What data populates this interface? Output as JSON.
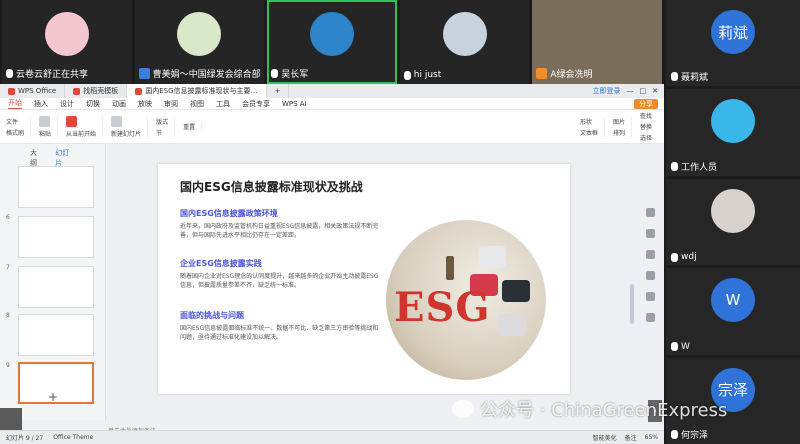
{
  "meeting": {
    "top_tiles": [
      {
        "label": "云卷云舒正在共享",
        "color": "#f3c6d0"
      },
      {
        "label": "曹美娟～中国绿发会综合部",
        "color": "#d9e8c8"
      },
      {
        "label": "吴长军",
        "color": "#2d84c8"
      },
      {
        "label": "hi just",
        "color": "#c8d2dc"
      },
      {
        "label": "A绿会冼明",
        "color": "#7a6d5b"
      }
    ],
    "right_tiles": [
      {
        "label": "聂莉斌",
        "avatar_text": "莉斌",
        "color": "#2f73d9"
      },
      {
        "label": "工作人员",
        "avatar_text": "",
        "color": "#39b7e8"
      },
      {
        "label": "wdj",
        "avatar_text": "",
        "color": "#d8d2cc"
      },
      {
        "label": "W",
        "avatar_text": "W",
        "color": "#2f73d9"
      },
      {
        "label": "何宗泽",
        "avatar_text": "宗泽",
        "color": "#2f73d9"
      }
    ]
  },
  "wps": {
    "tabs": [
      {
        "label": "WPS Office"
      },
      {
        "label": "找稻壳模板"
      },
      {
        "label": "国内ESG信息披露标准现状与主要…"
      }
    ],
    "login_label": "立即登录",
    "menu": [
      "开始",
      "插入",
      "设计",
      "切换",
      "动画",
      "放映",
      "审阅",
      "视图",
      "工具",
      "会员专享",
      "WPS AI"
    ],
    "share_label": "分享",
    "toolbar": [
      "文件",
      "格式刷",
      "粘贴",
      "从当前开始",
      "新建幻灯片",
      "版式",
      "节",
      "重置",
      "形状",
      "图片",
      "查找",
      "文本框",
      "排列",
      "替换",
      "选择"
    ],
    "left_tabs": [
      "大纲",
      "幻灯片"
    ],
    "slide_numbers": [
      "6",
      "7",
      "8",
      "9"
    ],
    "add_slide": "+",
    "notes_placeholder": "单击此处添加备注",
    "status": {
      "slide_count": "幻灯片 9 / 27",
      "theme": "Office Theme",
      "beautify": "智能美化",
      "notes": "备注",
      "zoom": "65%"
    }
  },
  "slide": {
    "title": "国内ESG信息披露标准现状及挑战",
    "sections": [
      {
        "heading": "国内ESG信息披露政策环境",
        "text": "近年来，国内政府及监管机构日益重视ESG信息披露，相关政策法规不断完善，但与国际先进水平相比仍存在一定差距。"
      },
      {
        "heading": "企业ESG信息披露实践",
        "text": "随着国内企业对ESG理念的认同度提升，越来越多的企业开始主动披露ESG信息，但披露质量参差不齐，缺乏统一标准。"
      },
      {
        "heading": "面临的挑战与问题",
        "text": "国内ESG信息披露面临标准不统一、数据不可比、缺乏第三方审验等挑战和问题，亟待通过标准化建设加以解决。"
      }
    ],
    "art_word": "ESG"
  },
  "watermark": "公众号 · ChinaGreenExpress"
}
